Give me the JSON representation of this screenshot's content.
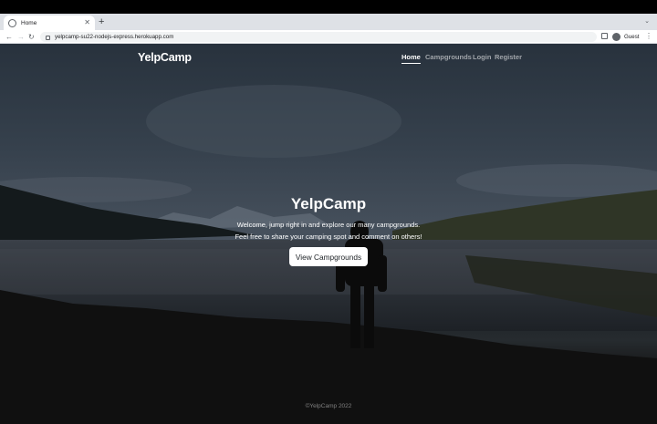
{
  "browser": {
    "tab_title": "Home",
    "tab_close": "✕",
    "new_tab": "+",
    "tab_menu": "⌄",
    "back": "←",
    "forward": "→",
    "reload": "↻",
    "url": "yelpcamp-su22-nodejs-express.herokuapp.com",
    "profile_label": "Guest",
    "menu": "⋮"
  },
  "navbar": {
    "brand": "YelpCamp",
    "links": [
      "Home",
      "Campgrounds",
      "Login",
      "Register"
    ],
    "active": "Home"
  },
  "hero": {
    "title": "YelpCamp",
    "line1": "Welcome, jump right in and explore our many campgrounds.",
    "line2": "Feel free to share your camping spot and comment on others!",
    "button_label": "View Campgrounds"
  },
  "footer": {
    "text": "©YelpCamp 2022"
  },
  "colors": {
    "overlay": "#1e2730",
    "button_bg": "#ffffff",
    "text": "#ffffff"
  }
}
